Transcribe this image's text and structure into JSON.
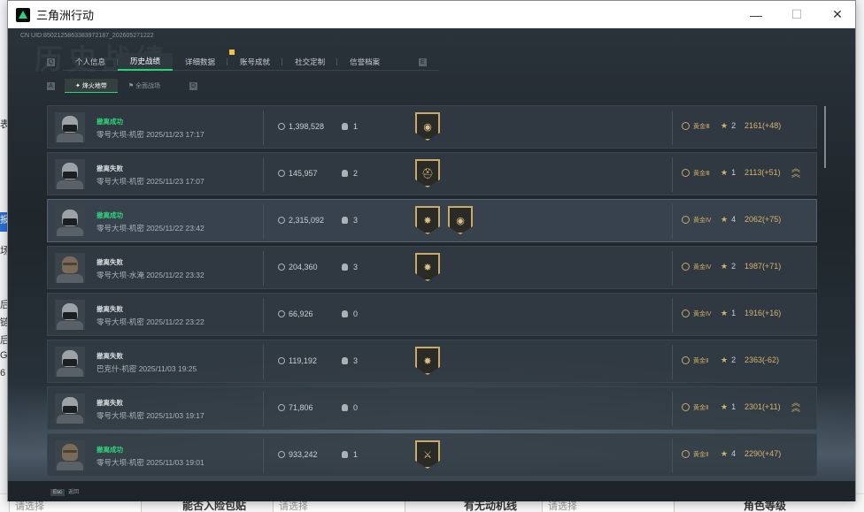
{
  "window": {
    "title": "三角洲行动"
  },
  "header": {
    "uid": "CN UID:8502125863383972187_202605271222",
    "watermark": "历史战绩"
  },
  "tabs": [
    {
      "label": "个人信息",
      "active": false
    },
    {
      "label": "历史战绩",
      "active": true
    },
    {
      "label": "详细数据",
      "active": false
    },
    {
      "label": "账号成就",
      "active": false
    },
    {
      "label": "社交定制",
      "active": false
    },
    {
      "label": "信誉档案",
      "active": false
    }
  ],
  "subtabs": [
    {
      "label": "烽火地带",
      "active": true
    },
    {
      "label": "全面战场",
      "active": false
    }
  ],
  "records": [
    {
      "result": "撤离成功",
      "status": "success",
      "map": "零号大坝-机密 2025/11/23 17:17",
      "money": "1,398,528",
      "kills": "1",
      "badges": [
        "medal-ring"
      ],
      "rank": "黄金Ⅲ",
      "stars": "2",
      "score": "2161(+48)",
      "chevron": false,
      "avatar": "masked"
    },
    {
      "result": "撤离失败",
      "status": "fail",
      "map": "零号大坝-机密 2025/11/23 17:07",
      "money": "145,957",
      "kills": "2",
      "badges": [
        "medal-helm"
      ],
      "rank": "黄金Ⅲ",
      "stars": "1",
      "score": "2113(+51)",
      "chevron": true,
      "avatar": "masked"
    },
    {
      "result": "撤离成功",
      "status": "success",
      "map": "零号大坝-机密 2025/11/22 23:42",
      "money": "2,315,092",
      "kills": "3",
      "badges": [
        "medal-star",
        "medal-ring"
      ],
      "rank": "黄金Ⅳ",
      "stars": "4",
      "score": "2062(+75)",
      "chevron": false,
      "avatar": "masked"
    },
    {
      "result": "撤离失败",
      "status": "fail",
      "map": "零号大坝-水淹 2025/11/22 23:32",
      "money": "204,360",
      "kills": "3",
      "badges": [
        "medal-star"
      ],
      "rank": "黄金Ⅳ",
      "stars": "2",
      "score": "1987(+71)",
      "chevron": false,
      "avatar": "soldier"
    },
    {
      "result": "撤离失败",
      "status": "fail",
      "map": "零号大坝-机密 2025/11/22 23:22",
      "money": "66,926",
      "kills": "0",
      "badges": [],
      "rank": "黄金Ⅳ",
      "stars": "1",
      "score": "1916(+16)",
      "chevron": false,
      "avatar": "masked"
    },
    {
      "result": "撤离失败",
      "status": "fail",
      "map": "巴克什-机密 2025/11/03 19:25",
      "money": "119,192",
      "kills": "3",
      "badges": [
        "medal-star"
      ],
      "rank": "黄金Ⅱ",
      "stars": "2",
      "score": "2363(-62)",
      "chevron": false,
      "avatar": "masked"
    },
    {
      "result": "撤离失败",
      "status": "fail",
      "map": "零号大坝-机密 2025/11/03 19:17",
      "money": "71,806",
      "kills": "0",
      "badges": [],
      "rank": "黄金Ⅱ",
      "stars": "1",
      "score": "2301(+11)",
      "chevron": true,
      "avatar": "masked"
    },
    {
      "result": "撤离成功",
      "status": "success",
      "map": "零号大坝-机密 2025/11/03 19:01",
      "money": "933,242",
      "kills": "1",
      "badges": [
        "medal-sword"
      ],
      "rank": "黄金Ⅱ",
      "stars": "4",
      "score": "2290(+47)",
      "chevron": false,
      "avatar": "soldier"
    }
  ],
  "footer": {
    "key": "Esc",
    "label": "返回"
  },
  "background": {
    "left_fragments": [
      "表",
      "报",
      "场",
      "后",
      "链",
      "后",
      "G",
      "6"
    ],
    "bottom_labels": [
      "请选择",
      "能否入险包贴",
      "请选择",
      "有无动机线",
      "请选择",
      "角色等级"
    ]
  },
  "colors": {
    "success": "#2ed47b",
    "accent": "#29d37a",
    "gold": "#d8b26a",
    "panel": "#2f3a42"
  }
}
